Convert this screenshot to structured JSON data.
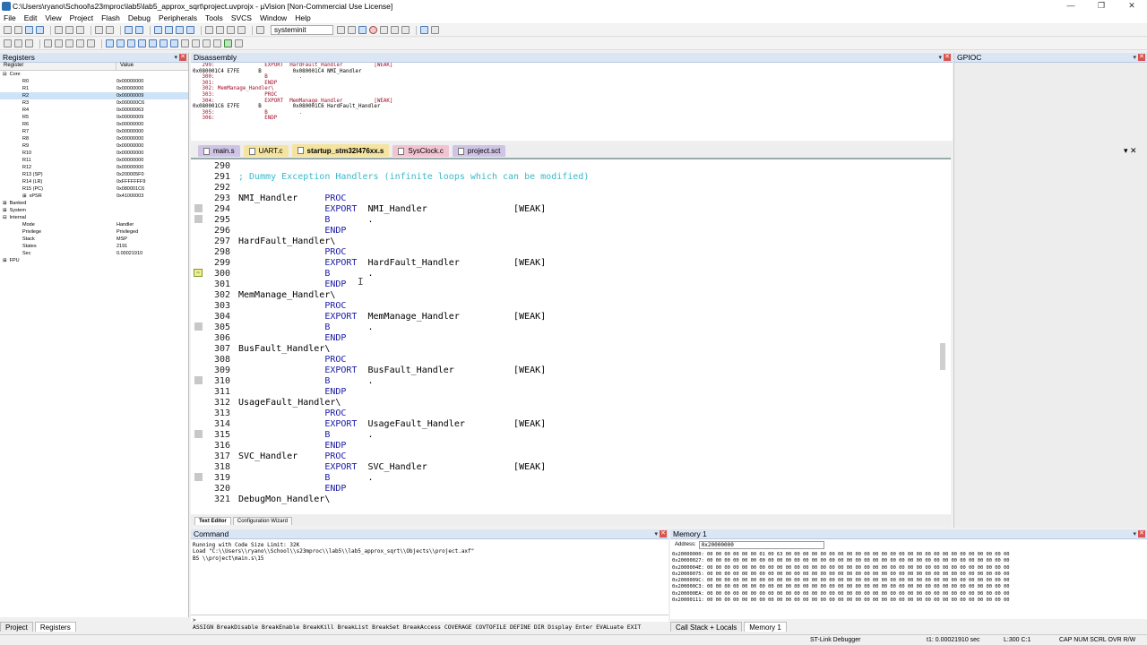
{
  "window": {
    "title": "C:\\Users\\ryano\\School\\s23mproc\\lab5\\lab5_approx_sqrt\\project.uvprojx - µVision  [Non-Commercial Use License]",
    "minimize": "—",
    "maximize": "❐",
    "close": "✕"
  },
  "menu": [
    "File",
    "Edit",
    "View",
    "Project",
    "Flash",
    "Debug",
    "Peripherals",
    "Tools",
    "SVCS",
    "Window",
    "Help"
  ],
  "toolbar": {
    "function_combo": "systeminit"
  },
  "registers": {
    "title": "Registers",
    "col_register": "Register",
    "col_value": "Value",
    "rows": [
      {
        "name": "Core",
        "value": "",
        "level": 0,
        "expander": "⊟"
      },
      {
        "name": "R0",
        "value": "0x00000000",
        "level": 1
      },
      {
        "name": "R1",
        "value": "0x00000000",
        "level": 1
      },
      {
        "name": "R2",
        "value": "0x00000009",
        "level": 1,
        "selected": true
      },
      {
        "name": "R3",
        "value": "0x000000C6",
        "level": 1
      },
      {
        "name": "R4",
        "value": "0x00000063",
        "level": 1
      },
      {
        "name": "R5",
        "value": "0x00000009",
        "level": 1
      },
      {
        "name": "R6",
        "value": "0x00000000",
        "level": 1
      },
      {
        "name": "R7",
        "value": "0x00000000",
        "level": 1
      },
      {
        "name": "R8",
        "value": "0x00000000",
        "level": 1
      },
      {
        "name": "R9",
        "value": "0x00000000",
        "level": 1
      },
      {
        "name": "R10",
        "value": "0x00000000",
        "level": 1
      },
      {
        "name": "R11",
        "value": "0x00000000",
        "level": 1
      },
      {
        "name": "R12",
        "value": "0x00000000",
        "level": 1
      },
      {
        "name": "R13 (SP)",
        "value": "0x200005F0",
        "level": 1
      },
      {
        "name": "R14 (LR)",
        "value": "0xFFFFFFF9",
        "level": 1
      },
      {
        "name": "R15 (PC)",
        "value": "0x080001C6",
        "level": 1
      },
      {
        "name": "xPSR",
        "value": "0x41000003",
        "level": 1,
        "expander": "⊞"
      },
      {
        "name": "Banked",
        "value": "",
        "level": 0,
        "expander": "⊞"
      },
      {
        "name": "System",
        "value": "",
        "level": 0,
        "expander": "⊞"
      },
      {
        "name": "Internal",
        "value": "",
        "level": 0,
        "expander": "⊟"
      },
      {
        "name": "Mode",
        "value": "Handler",
        "level": 1
      },
      {
        "name": "Privilege",
        "value": "Privileged",
        "level": 1
      },
      {
        "name": "Stack",
        "value": "MSP",
        "level": 1
      },
      {
        "name": "States",
        "value": "2191",
        "level": 1
      },
      {
        "name": "Sec",
        "value": "0.00021910",
        "level": 1
      },
      {
        "name": "FPU",
        "value": "",
        "level": 0,
        "expander": "⊞"
      }
    ]
  },
  "disassembly": {
    "title": "Disassembly",
    "lines": [
      {
        "t": "   299:                EXPORT  HardFault_Handler          [WEAK]",
        "red": true
      },
      {
        "t": "0x080001C4 E7FE      B          0x080001C4 NMI_Handler",
        "red": false
      },
      {
        "t": "   300:                B          .",
        "red": true
      },
      {
        "t": "   301:                ENDP",
        "red": true
      },
      {
        "t": "   302: MemManage_Handler\\",
        "red": true
      },
      {
        "t": "   303:                PROC",
        "red": true
      },
      {
        "t": "   304:                EXPORT  MemManage_Handler          [WEAK]",
        "red": true
      },
      {
        "t": "0x080001C6 E7FE      B          0x080001C6 HardFault_Handler",
        "red": false
      },
      {
        "t": "   305:                B          .",
        "red": true
      },
      {
        "t": "   306:                ENDP",
        "red": true
      }
    ]
  },
  "gpioc": {
    "title": "GPIOC"
  },
  "tabs": [
    {
      "label": "main.s",
      "color": "#cfc4e6"
    },
    {
      "label": "UART.c",
      "color": "#f4e4a0"
    },
    {
      "label": "startup_stm32l476xx.s",
      "color": "#f4e4a0",
      "active": true
    },
    {
      "label": "SysClock.c",
      "color": "#f2c4d2"
    },
    {
      "label": "project.sct",
      "color": "#cfc4e6"
    }
  ],
  "code": [
    {
      "n": "290",
      "parts": []
    },
    {
      "n": "291",
      "parts": [
        {
          "c": "cm",
          "t": "; Dummy Exception Handlers (infinite loops which can be modified)"
        }
      ]
    },
    {
      "n": "292",
      "parts": []
    },
    {
      "n": "293",
      "parts": [
        {
          "c": "",
          "t": "NMI_Handler     "
        },
        {
          "c": "kw",
          "t": "PROC"
        }
      ]
    },
    {
      "n": "294",
      "parts": [
        {
          "c": "",
          "t": "                "
        },
        {
          "c": "kw",
          "t": "EXPORT"
        },
        {
          "c": "",
          "t": "  NMI_Handler                [WEAK]"
        }
      ],
      "mark": true
    },
    {
      "n": "295",
      "parts": [
        {
          "c": "",
          "t": "                "
        },
        {
          "c": "kw",
          "t": "B"
        },
        {
          "c": "",
          "t": "       ."
        }
      ],
      "mark": true
    },
    {
      "n": "296",
      "parts": [
        {
          "c": "",
          "t": "                "
        },
        {
          "c": "kw",
          "t": "ENDP"
        }
      ]
    },
    {
      "n": "297",
      "parts": [
        {
          "c": "",
          "t": "HardFault_Handler\\"
        }
      ]
    },
    {
      "n": "298",
      "parts": [
        {
          "c": "",
          "t": "                "
        },
        {
          "c": "kw",
          "t": "PROC"
        }
      ]
    },
    {
      "n": "299",
      "parts": [
        {
          "c": "",
          "t": "                "
        },
        {
          "c": "kw",
          "t": "EXPORT"
        },
        {
          "c": "",
          "t": "  HardFault_Handler          [WEAK]"
        }
      ]
    },
    {
      "n": "300",
      "parts": [
        {
          "c": "",
          "t": "                "
        },
        {
          "c": "kw",
          "t": "B"
        },
        {
          "c": "",
          "t": "       ."
        }
      ],
      "current": true
    },
    {
      "n": "301",
      "parts": [
        {
          "c": "",
          "t": "                "
        },
        {
          "c": "kw",
          "t": "ENDP"
        }
      ]
    },
    {
      "n": "302",
      "parts": [
        {
          "c": "",
          "t": "MemManage_Handler\\"
        }
      ]
    },
    {
      "n": "303",
      "parts": [
        {
          "c": "",
          "t": "                "
        },
        {
          "c": "kw",
          "t": "PROC"
        }
      ]
    },
    {
      "n": "304",
      "parts": [
        {
          "c": "",
          "t": "                "
        },
        {
          "c": "kw",
          "t": "EXPORT"
        },
        {
          "c": "",
          "t": "  MemManage_Handler          [WEAK]"
        }
      ]
    },
    {
      "n": "305",
      "parts": [
        {
          "c": "",
          "t": "                "
        },
        {
          "c": "kw",
          "t": "B"
        },
        {
          "c": "",
          "t": "       ."
        }
      ],
      "mark": true
    },
    {
      "n": "306",
      "parts": [
        {
          "c": "",
          "t": "                "
        },
        {
          "c": "kw",
          "t": "ENDP"
        }
      ]
    },
    {
      "n": "307",
      "parts": [
        {
          "c": "",
          "t": "BusFault_Handler\\"
        }
      ]
    },
    {
      "n": "308",
      "parts": [
        {
          "c": "",
          "t": "                "
        },
        {
          "c": "kw",
          "t": "PROC"
        }
      ]
    },
    {
      "n": "309",
      "parts": [
        {
          "c": "",
          "t": "                "
        },
        {
          "c": "kw",
          "t": "EXPORT"
        },
        {
          "c": "",
          "t": "  BusFault_Handler           [WEAK]"
        }
      ]
    },
    {
      "n": "310",
      "parts": [
        {
          "c": "",
          "t": "                "
        },
        {
          "c": "kw",
          "t": "B"
        },
        {
          "c": "",
          "t": "       ."
        }
      ],
      "mark": true
    },
    {
      "n": "311",
      "parts": [
        {
          "c": "",
          "t": "                "
        },
        {
          "c": "kw",
          "t": "ENDP"
        }
      ]
    },
    {
      "n": "312",
      "parts": [
        {
          "c": "",
          "t": "UsageFault_Handler\\"
        }
      ]
    },
    {
      "n": "313",
      "parts": [
        {
          "c": "",
          "t": "                "
        },
        {
          "c": "kw",
          "t": "PROC"
        }
      ]
    },
    {
      "n": "314",
      "parts": [
        {
          "c": "",
          "t": "                "
        },
        {
          "c": "kw",
          "t": "EXPORT"
        },
        {
          "c": "",
          "t": "  UsageFault_Handler         [WEAK]"
        }
      ]
    },
    {
      "n": "315",
      "parts": [
        {
          "c": "",
          "t": "                "
        },
        {
          "c": "kw",
          "t": "B"
        },
        {
          "c": "",
          "t": "       ."
        }
      ],
      "mark": true
    },
    {
      "n": "316",
      "parts": [
        {
          "c": "",
          "t": "                "
        },
        {
          "c": "kw",
          "t": "ENDP"
        }
      ]
    },
    {
      "n": "317",
      "parts": [
        {
          "c": "",
          "t": "SVC_Handler     "
        },
        {
          "c": "kw",
          "t": "PROC"
        }
      ]
    },
    {
      "n": "318",
      "parts": [
        {
          "c": "",
          "t": "                "
        },
        {
          "c": "kw",
          "t": "EXPORT"
        },
        {
          "c": "",
          "t": "  SVC_Handler                [WEAK]"
        }
      ]
    },
    {
      "n": "319",
      "parts": [
        {
          "c": "",
          "t": "                "
        },
        {
          "c": "kw",
          "t": "B"
        },
        {
          "c": "",
          "t": "       ."
        }
      ],
      "mark": true
    },
    {
      "n": "320",
      "parts": [
        {
          "c": "",
          "t": "                "
        },
        {
          "c": "kw",
          "t": "ENDP"
        }
      ]
    },
    {
      "n": "321",
      "parts": [
        {
          "c": "",
          "t": "DebugMon_Handler\\"
        }
      ]
    }
  ],
  "editor_tabs": [
    "Text Editor",
    "Configuration Wizard"
  ],
  "command": {
    "title": "Command",
    "output": [
      "Running with Code Size Limit: 32K",
      "Load \"C:\\\\Users\\\\ryano\\\\School\\\\s23mproc\\\\lab5\\\\lab5_approx_sqrt\\\\Objects\\\\project.axf\"",
      "BS \\\\project\\main.s\\15"
    ],
    "prompt": ">",
    "keywords": "ASSIGN BreakDisable BreakEnable BreakKill BreakList BreakSet BreakAccess COVERAGE COVTOFILE DEFINE DIR Display Enter EVALuate EXIT"
  },
  "memory": {
    "title": "Memory 1",
    "address_label": "Address:",
    "address_value": "0x20000000",
    "lines": [
      "0x20000000: 00 00 00 00 00 00 01 00 63 00 00 00 00 00 00 00 00 00 00 00 00 00 00 00 00 00 00 00 00 00 00 00 00 00 00",
      "0x20000027: 00 00 00 00 00 00 00 00 00 00 00 00 00 00 00 00 00 00 00 00 00 00 00 00 00 00 00 00 00 00 00 00 00 00 00",
      "0x2000004E: 00 00 00 00 00 00 00 00 00 00 00 00 00 00 00 00 00 00 00 00 00 00 00 00 00 00 00 00 00 00 00 00 00 00 00",
      "0x20000075: 00 00 00 00 00 00 00 00 00 00 00 00 00 00 00 00 00 00 00 00 00 00 00 00 00 00 00 00 00 00 00 00 00 00 00",
      "0x2000009C: 00 00 00 00 00 00 00 00 00 00 00 00 00 00 00 00 00 00 00 00 00 00 00 00 00 00 00 00 00 00 00 00 00 00 00",
      "0x200000C3: 00 00 00 00 00 00 00 00 00 00 00 00 00 00 00 00 00 00 00 00 00 00 00 00 00 00 00 00 00 00 00 00 00 00 00",
      "0x200000EA: 00 00 00 00 00 00 00 00 00 00 00 00 00 00 00 00 00 00 00 00 00 00 00 00 00 00 00 00 00 00 00 00 00 00 00",
      "0x20000111: 00 00 00 00 00 00 00 00 00 00 00 00 00 00 00 00 00 00 00 00 00 00 00 00 00 00 00 00 00 00 00 00 00 00 00"
    ]
  },
  "bottom_tabs_left": [
    {
      "label": "Project"
    },
    {
      "label": "Registers",
      "active": true
    }
  ],
  "bottom_tabs_right": [
    {
      "label": "Call Stack + Locals"
    },
    {
      "label": "Memory 1",
      "active": true
    }
  ],
  "status": {
    "debugger": "ST-Link Debugger",
    "time": "t1: 0.00021910 sec",
    "position": "L:300 C:1",
    "indicators": "CAP  NUM  SCRL  OVR  R/W"
  }
}
